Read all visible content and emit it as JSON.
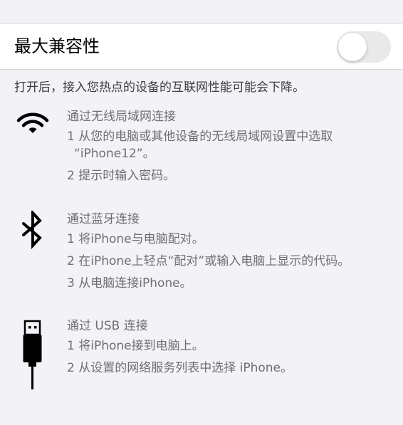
{
  "hotspot": {
    "toggle_label": "最大兼容性",
    "toggle_on": false,
    "footer_text": "打开后，接入您热点的设备的互联网性能可能会下降。"
  },
  "sections": [
    {
      "icon": "wifi-icon",
      "heading": "通过无线局域网连接",
      "steps": [
        "1 从您的电脑或其他设备的无线局域网设置中选取",
        "“iPhone12”。",
        "2 提示时输入密码。"
      ]
    },
    {
      "icon": "bluetooth-icon",
      "heading": "通过蓝牙连接",
      "steps": [
        "1 将iPhone与电脑配对。",
        "2 在iPhone上轻点“配对”或输入电脑上显示的代码。",
        "3 从电脑连接iPhone。"
      ]
    },
    {
      "icon": "usb-cable-icon",
      "heading": "通过 USB 连接",
      "steps": [
        "1 将iPhone接到电脑上。",
        "2 从设置的网络服务列表中选择 iPhone。"
      ]
    }
  ],
  "colors": {
    "background": "#f2f2f7",
    "cell": "#ffffff",
    "switch_off": "#e9e9ea",
    "secondary_text": "#6e6e73"
  }
}
